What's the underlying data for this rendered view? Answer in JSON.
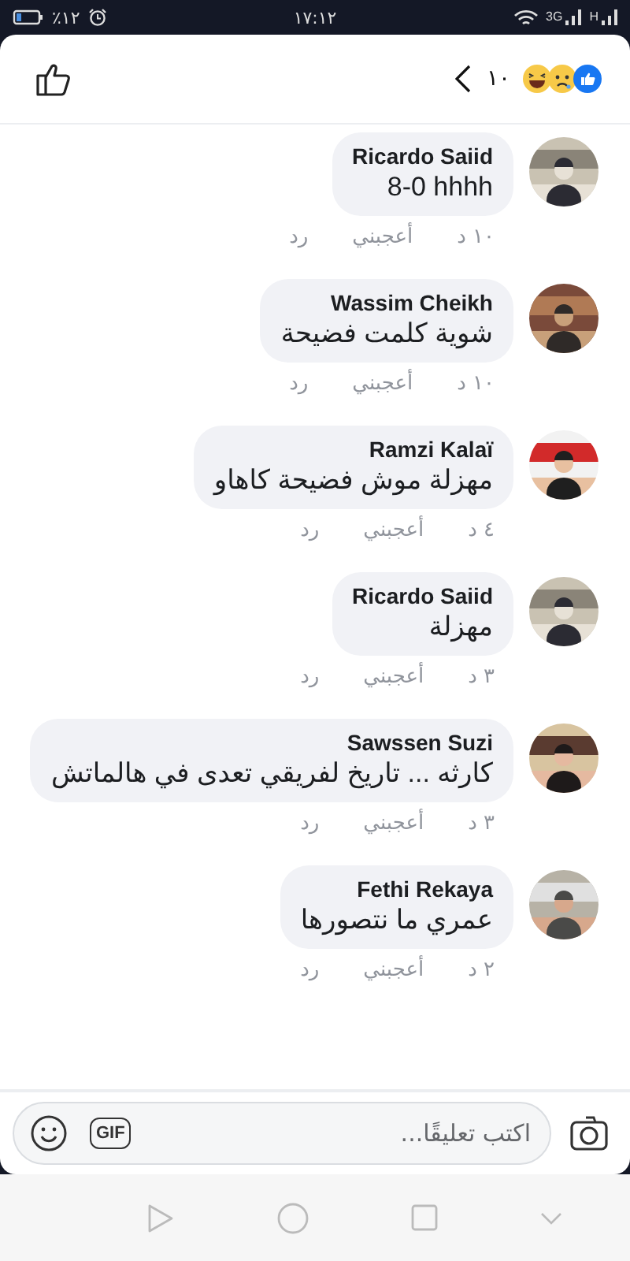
{
  "status_bar": {
    "battery": "٪١٢",
    "time": "١٧:١٢",
    "network_labels": [
      "H",
      "3G"
    ]
  },
  "header": {
    "reaction_count": "١٠"
  },
  "comments": [
    {
      "author": "Ricardo Saiid",
      "text": "8-0 hhhh",
      "time": "١٠ د",
      "like": "أعجبني",
      "reply": "رد"
    },
    {
      "author": "Wassim Cheikh",
      "text": "شوية كلمت فضيحة",
      "time": "١٠ د",
      "like": "أعجبني",
      "reply": "رد"
    },
    {
      "author": "Ramzi Kalaï",
      "text": "مهزلة موش فضيحة كاهاو",
      "time": "٤ د",
      "like": "أعجبني",
      "reply": "رد"
    },
    {
      "author": "Ricardo Saiid",
      "text": "مهزلة",
      "time": "٣ د",
      "like": "أعجبني",
      "reply": "رد"
    },
    {
      "author": "Sawssen Suzi",
      "text": "كارثه ... تاريخ لفريقي تعدى في هالماتش",
      "time": "٣ د",
      "like": "أعجبني",
      "reply": "رد"
    },
    {
      "author": "Fethi Rekaya",
      "text": "عمري ما نتصورها",
      "time": "٢ د",
      "like": "أعجبني",
      "reply": "رد"
    }
  ],
  "composer": {
    "placeholder": "اكتب تعليقًا...",
    "gif_label": "GIF"
  }
}
